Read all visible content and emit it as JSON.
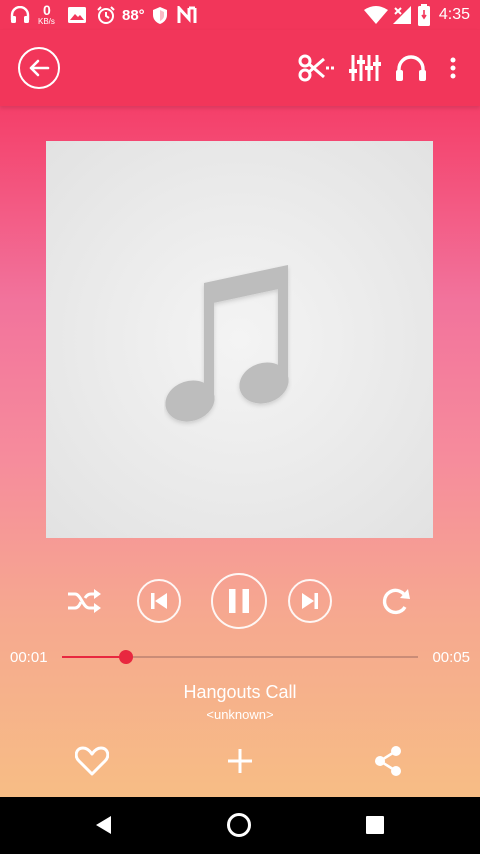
{
  "status_bar": {
    "net_speed_value": "0",
    "net_speed_unit": "KB/s",
    "temperature": "88°",
    "time": "4:35"
  },
  "player": {
    "elapsed": "00:01",
    "duration": "00:05",
    "progress": 0.18,
    "title": "Hangouts Call",
    "artist": "<unknown>"
  },
  "icons": {
    "back": "arrow-left-icon",
    "cut": "scissors-icon",
    "equalizer": "equalizer-icon",
    "headset": "headphones-icon",
    "more": "more-vert-icon",
    "shuffle": "shuffle-icon",
    "previous": "skip-previous-icon",
    "pause": "pause-icon",
    "next": "skip-next-icon",
    "repeat": "repeat-icon",
    "favorite": "heart-icon",
    "add": "plus-icon",
    "share": "share-icon"
  },
  "colors": {
    "accent": "#f2365a",
    "seek": "#e8283f"
  }
}
